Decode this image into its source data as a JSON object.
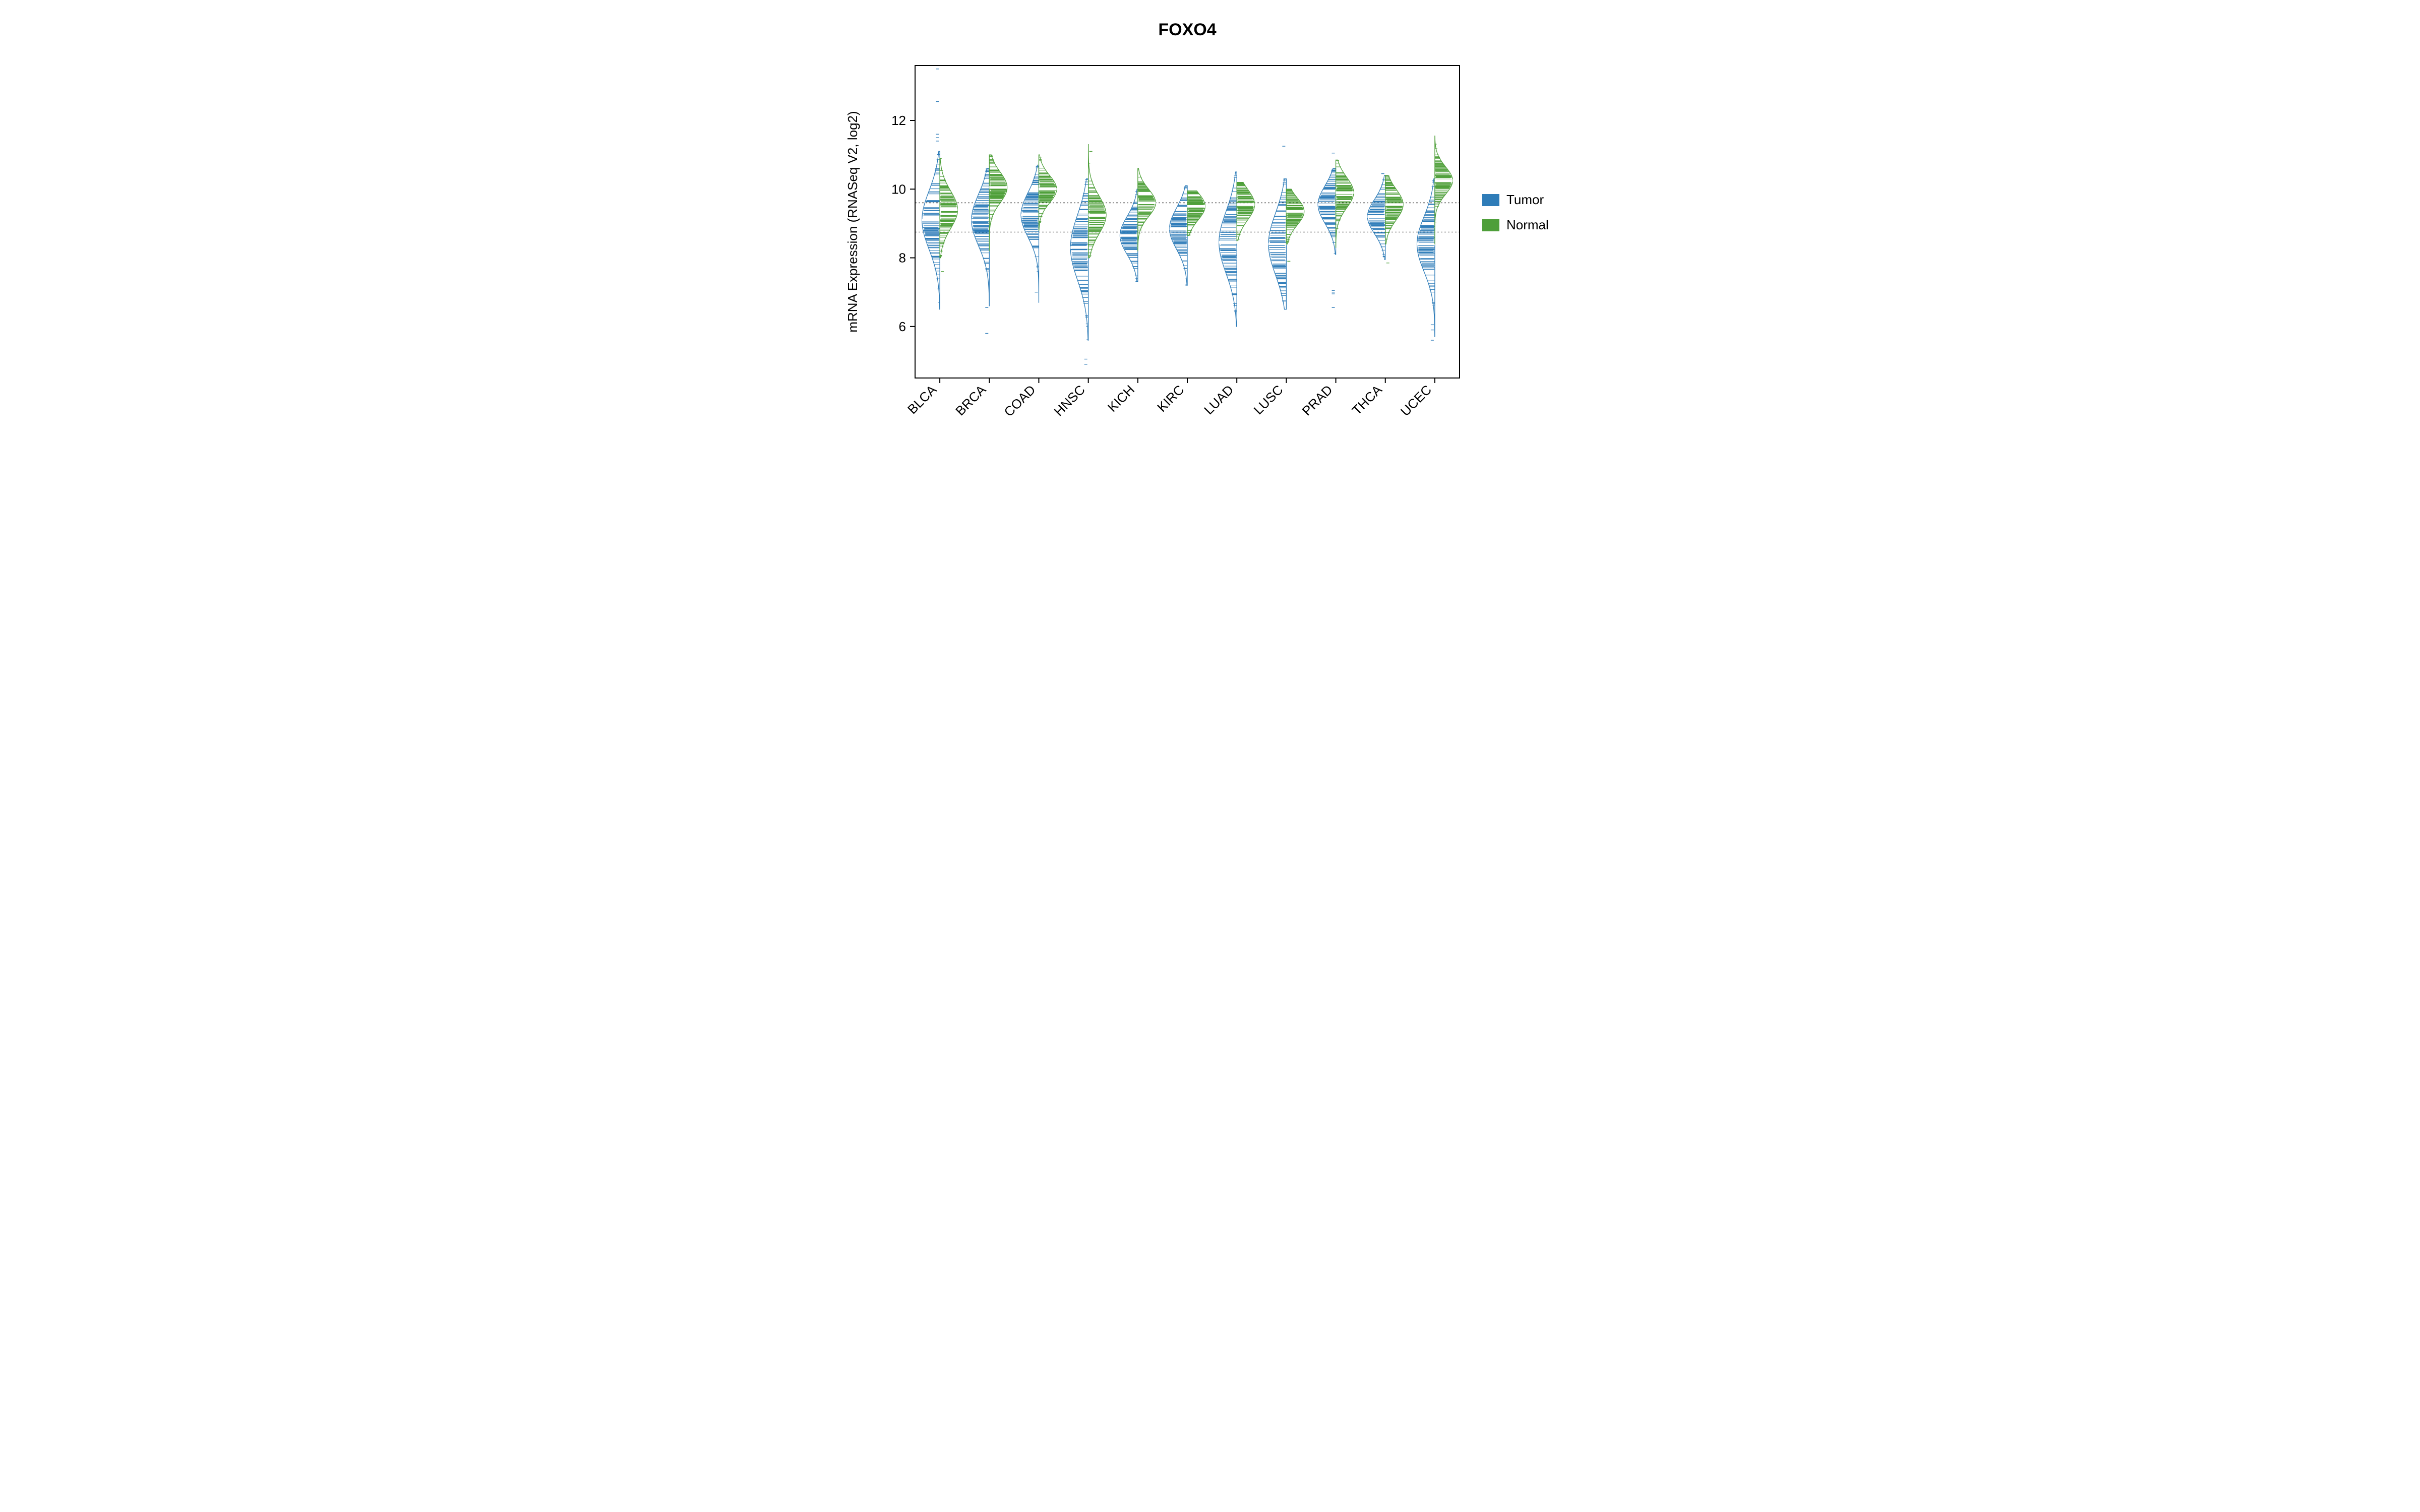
{
  "chart_data": {
    "type": "beanplot",
    "title": "FOXO4",
    "ylabel": "mRNA Expression (RNASeq V2, log2)",
    "xlabel": "",
    "ylim": [
      4.5,
      13.6
    ],
    "yticks": [
      6,
      8,
      10,
      12
    ],
    "ref_lines": [
      8.75,
      9.6
    ],
    "categories": [
      "BLCA",
      "BRCA",
      "COAD",
      "HNSC",
      "KICH",
      "KIRC",
      "LUAD",
      "LUSC",
      "PRAD",
      "THCA",
      "UCEC"
    ],
    "series": [
      {
        "name": "Tumor",
        "color": "#2E7CB8",
        "side": "left",
        "medians": [
          9.1,
          9.1,
          9.25,
          8.3,
          8.65,
          8.85,
          8.45,
          8.4,
          9.55,
          9.2,
          8.4
        ]
      },
      {
        "name": "Normal",
        "color": "#4E9F39",
        "side": "right",
        "medians": [
          9.4,
          10.05,
          10.0,
          9.25,
          9.6,
          9.5,
          9.55,
          9.35,
          9.9,
          9.55,
          10.25
        ]
      }
    ],
    "tumor_dist": [
      {
        "mean": 9.1,
        "sd": 0.85,
        "lo": 6.5,
        "hi": 11.1,
        "outliers": [
          13.5,
          12.55,
          11.5,
          11.4,
          11.6
        ]
      },
      {
        "mean": 9.1,
        "sd": 0.75,
        "lo": 6.6,
        "hi": 10.6,
        "outliers": [
          5.8,
          6.55
        ]
      },
      {
        "mean": 9.25,
        "sd": 0.65,
        "lo": 6.7,
        "hi": 10.7,
        "outliers": [
          7.0
        ]
      },
      {
        "mean": 8.3,
        "sd": 0.95,
        "lo": 5.6,
        "hi": 10.3,
        "outliers": [
          4.9,
          5.05
        ]
      },
      {
        "mean": 8.65,
        "sd": 0.55,
        "lo": 7.3,
        "hi": 10.0,
        "outliers": []
      },
      {
        "mean": 8.85,
        "sd": 0.6,
        "lo": 7.2,
        "hi": 10.1,
        "outliers": []
      },
      {
        "mean": 8.45,
        "sd": 0.9,
        "lo": 6.0,
        "hi": 10.5,
        "outliers": []
      },
      {
        "mean": 8.4,
        "sd": 0.9,
        "lo": 6.5,
        "hi": 10.3,
        "outliers": [
          11.25
        ]
      },
      {
        "mean": 9.55,
        "sd": 0.55,
        "lo": 8.1,
        "hi": 10.6,
        "outliers": [
          6.95,
          7.0,
          7.05,
          6.55,
          11.05
        ]
      },
      {
        "mean": 9.2,
        "sd": 0.5,
        "lo": 7.95,
        "hi": 10.4,
        "outliers": [
          10.45
        ]
      },
      {
        "mean": 8.4,
        "sd": 0.8,
        "lo": 5.7,
        "hi": 10.3,
        "outliers": [
          5.6,
          5.9,
          6.05
        ]
      }
    ],
    "normal_dist": [
      {
        "mean": 9.4,
        "sd": 0.55,
        "lo": 8.0,
        "hi": 10.9,
        "outliers": [
          7.6
        ]
      },
      {
        "mean": 10.05,
        "sd": 0.45,
        "lo": 8.2,
        "hi": 11.0,
        "outliers": []
      },
      {
        "mean": 10.0,
        "sd": 0.4,
        "lo": 8.8,
        "hi": 11.0,
        "outliers": []
      },
      {
        "mean": 9.25,
        "sd": 0.55,
        "lo": 8.0,
        "hi": 11.3,
        "outliers": [
          11.1
        ]
      },
      {
        "mean": 9.6,
        "sd": 0.4,
        "lo": 8.2,
        "hi": 10.6,
        "outliers": []
      },
      {
        "mean": 9.5,
        "sd": 0.4,
        "lo": 8.65,
        "hi": 9.95,
        "outliers": []
      },
      {
        "mean": 9.55,
        "sd": 0.45,
        "lo": 8.5,
        "hi": 10.2,
        "outliers": []
      },
      {
        "mean": 9.35,
        "sd": 0.4,
        "lo": 8.4,
        "hi": 10.0,
        "outliers": [
          7.9
        ]
      },
      {
        "mean": 9.9,
        "sd": 0.45,
        "lo": 8.3,
        "hi": 10.85,
        "outliers": []
      },
      {
        "mean": 9.55,
        "sd": 0.45,
        "lo": 8.4,
        "hi": 10.4,
        "outliers": [
          7.85
        ]
      },
      {
        "mean": 10.25,
        "sd": 0.4,
        "lo": 8.4,
        "hi": 11.55,
        "outliers": []
      }
    ]
  },
  "legend": {
    "items": [
      {
        "label": "Tumor",
        "color": "#2E7CB8"
      },
      {
        "label": "Normal",
        "color": "#4E9F39"
      }
    ]
  }
}
